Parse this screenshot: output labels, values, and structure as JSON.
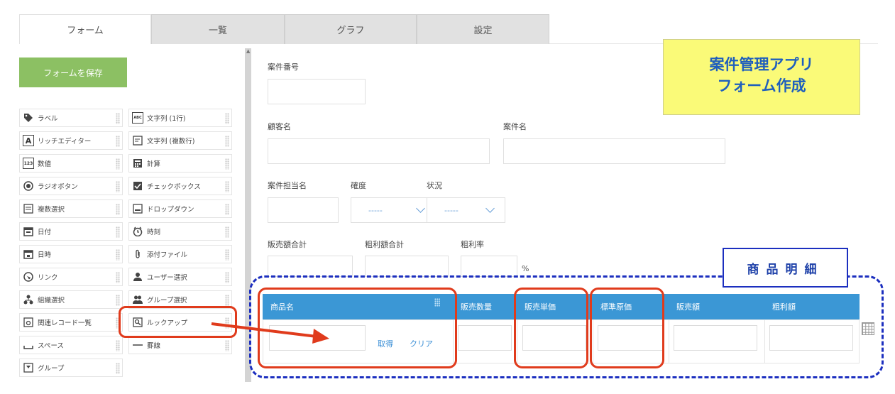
{
  "tabs": [
    {
      "label": "フォーム",
      "active": true
    },
    {
      "label": "一覧",
      "active": false
    },
    {
      "label": "グラフ",
      "active": false
    },
    {
      "label": "設定",
      "active": false
    }
  ],
  "save_button": "フォームを保存",
  "palette": {
    "left": [
      {
        "label": "ラベル",
        "icon": "tag-icon"
      },
      {
        "label": "リッチエディター",
        "icon": "rich-editor-icon"
      },
      {
        "label": "数値",
        "icon": "number-icon"
      },
      {
        "label": "ラジオボタン",
        "icon": "radio-icon"
      },
      {
        "label": "複数選択",
        "icon": "multi-select-icon"
      },
      {
        "label": "日付",
        "icon": "calendar-icon"
      },
      {
        "label": "日時",
        "icon": "datetime-icon"
      },
      {
        "label": "リンク",
        "icon": "globe-icon"
      },
      {
        "label": "組織選択",
        "icon": "org-icon"
      },
      {
        "label": "関連レコード一覧",
        "icon": "related-records-icon"
      },
      {
        "label": "スペース",
        "icon": "space-icon"
      },
      {
        "label": "グループ",
        "icon": "group-icon"
      }
    ],
    "right": [
      {
        "label": "文字列 (1行)",
        "icon": "text-line-icon"
      },
      {
        "label": "文字列 (複数行)",
        "icon": "text-multiline-icon"
      },
      {
        "label": "計算",
        "icon": "calculator-icon"
      },
      {
        "label": "チェックボックス",
        "icon": "checkbox-icon"
      },
      {
        "label": "ドロップダウン",
        "icon": "dropdown-icon"
      },
      {
        "label": "時刻",
        "icon": "clock-icon"
      },
      {
        "label": "添付ファイル",
        "icon": "paperclip-icon"
      },
      {
        "label": "ユーザー選択",
        "icon": "user-icon"
      },
      {
        "label": "グループ選択",
        "icon": "users-icon"
      },
      {
        "label": "ルックアップ",
        "icon": "lookup-icon"
      },
      {
        "label": "罫線",
        "icon": "line-icon"
      }
    ]
  },
  "form": {
    "case_number": "案件番号",
    "customer_name": "顧客名",
    "case_name": "案件名",
    "case_owner": "案件担当名",
    "certainty": "確度",
    "status": "状況",
    "dropdown_placeholder": "-----",
    "sales_total": "販売額合計",
    "gross_profit_total": "粗利額合計",
    "gross_margin": "粗利率",
    "percent_unit": "%"
  },
  "callout": {
    "line1": "案件管理アプリ",
    "line2": "フォーム作成"
  },
  "subtable": {
    "label": "商品明細",
    "columns": [
      "商品名",
      "販売数量",
      "販売単価",
      "標準原価",
      "販売額",
      "粗利額"
    ],
    "fetch_link": "取得",
    "clear_link": "クリア"
  },
  "colors": {
    "save_green": "#8cc063",
    "header_blue": "#3b97d5",
    "annotation_red": "#e03b1c",
    "annotation_blue": "#1c2fbf",
    "callout_yellow": "#fafa78"
  }
}
